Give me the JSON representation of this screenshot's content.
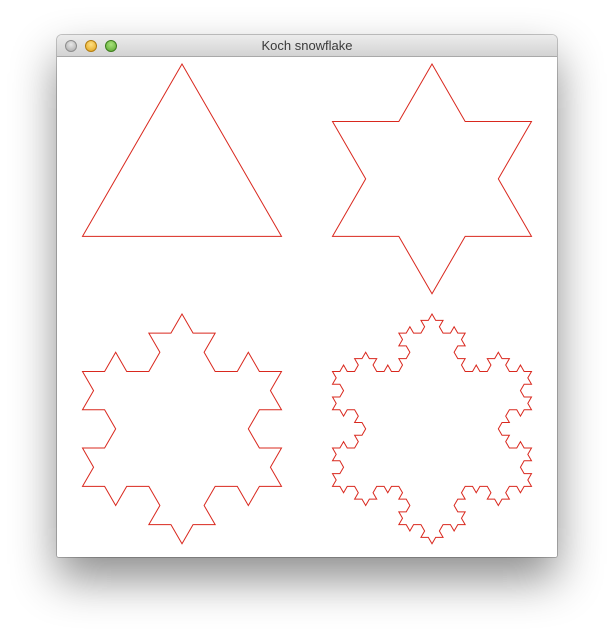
{
  "window": {
    "title": "Koch snowflake",
    "controls": [
      "close",
      "minimize",
      "zoom"
    ]
  },
  "figure": {
    "stroke_color": "#d9281e",
    "iterations": [
      0,
      1,
      2,
      3
    ]
  }
}
